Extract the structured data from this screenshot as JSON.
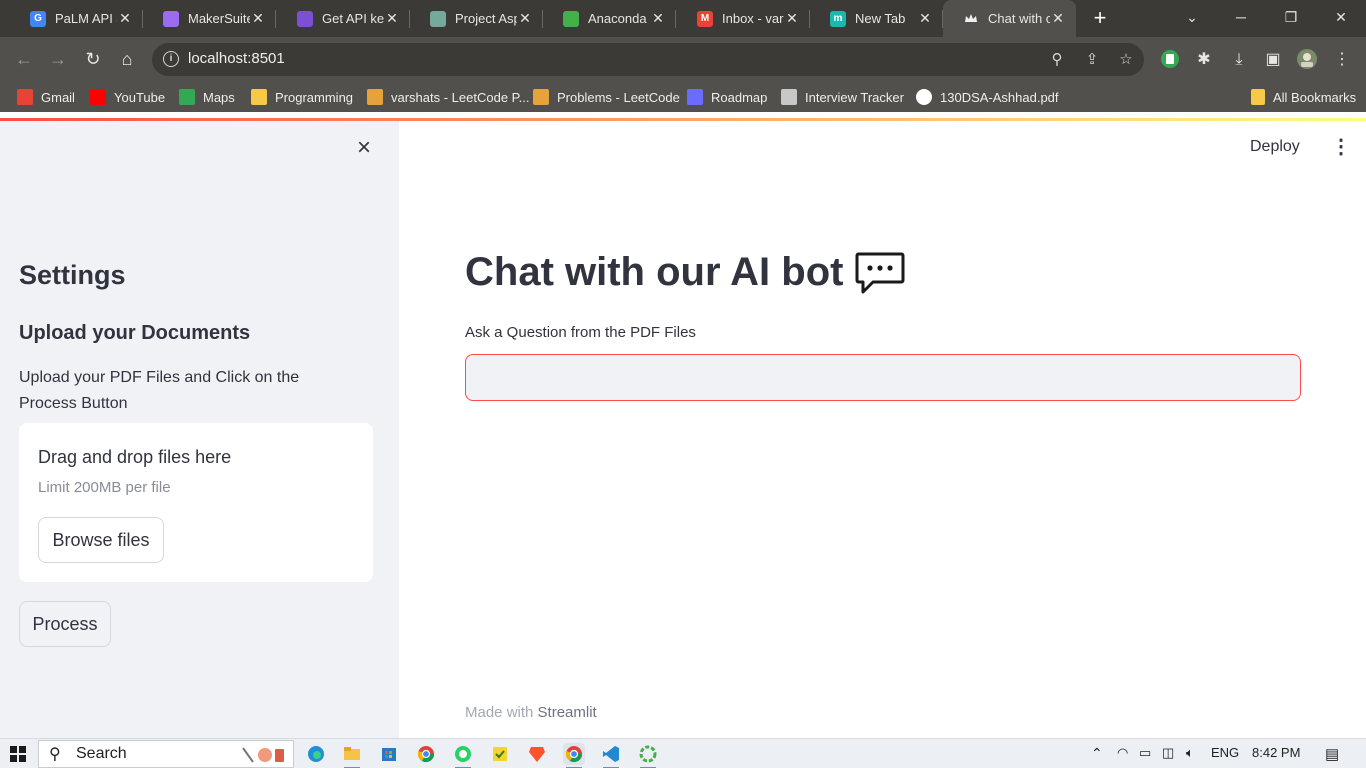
{
  "browser": {
    "tabs": [
      {
        "title": "PaLM API &",
        "color": "#4285f4",
        "glyph": "G",
        "active": false
      },
      {
        "title": "MakerSuite",
        "color": "#9b6bf0",
        "glyph": "",
        "active": false
      },
      {
        "title": "Get API key",
        "color": "#7b4fd6",
        "glyph": "",
        "active": false
      },
      {
        "title": "Project Asp",
        "color": "#74aa9c",
        "glyph": "",
        "active": false
      },
      {
        "title": "Anaconda C",
        "color": "#43b049",
        "glyph": "",
        "active": false
      },
      {
        "title": "Inbox - vars",
        "color": "#ea4335",
        "glyph": "M",
        "active": false
      },
      {
        "title": "New Tab",
        "color": "#1ab9b0",
        "glyph": "m",
        "active": false
      },
      {
        "title": "Chat with o",
        "color": "#f0f0f0",
        "glyph": "",
        "active": true
      }
    ],
    "new_tab_icon": "+",
    "url": "localhost:8501",
    "bookmarks": [
      {
        "label": "Gmail",
        "color": "#ea4335"
      },
      {
        "label": "YouTube",
        "color": "#ff0000"
      },
      {
        "label": "Maps",
        "color": "#34a853"
      },
      {
        "label": "Programming",
        "color": "#f7c948"
      },
      {
        "label": "varshats - LeetCode P...",
        "color": "#e6a23c"
      },
      {
        "label": "Problems - LeetCode",
        "color": "#e6a23c"
      },
      {
        "label": "Roadmap",
        "color": "#6b6bff"
      },
      {
        "label": "Interview Tracker",
        "color": "#c8c8c8"
      },
      {
        "label": "130DSA-Ashhad.pdf",
        "color": "#ffffff"
      }
    ],
    "all_bookmarks": "All Bookmarks"
  },
  "sidebar": {
    "heading": "Settings",
    "subheading": "Upload your Documents",
    "description": "Upload your PDF Files and Click on the Process Button",
    "uploader": {
      "title": "Drag and drop files here",
      "limit": "Limit 200MB per file",
      "browse_label": "Browse files"
    },
    "process_label": "Process"
  },
  "header": {
    "deploy_label": "Deploy"
  },
  "main": {
    "title": "Chat with our AI bot",
    "question_label": "Ask a Question from the PDF Files",
    "question_value": "",
    "footer_prefix": "Made with ",
    "footer_brand": "Streamlit"
  },
  "taskbar": {
    "search_label": "Search",
    "language": "ENG",
    "time": "8:42 PM"
  },
  "colors": {
    "accent": "#ff4b4b",
    "sidebar_bg": "#f0f2f6",
    "text": "#31333f"
  }
}
